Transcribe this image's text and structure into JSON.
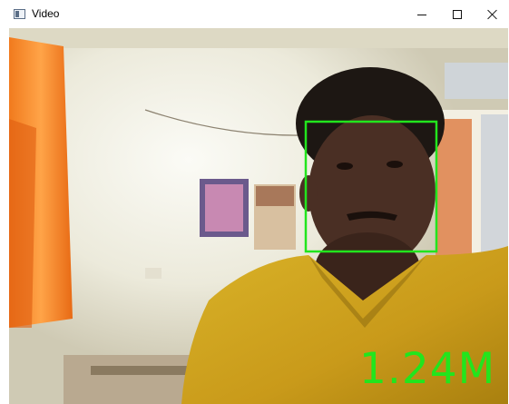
{
  "window": {
    "title": "Video",
    "icon": "app-window-icon",
    "controls": [
      "minimize-icon",
      "maximize-icon",
      "close-icon"
    ]
  },
  "video": {
    "overlay_text": "1.24M",
    "overlay_color": "#22e51d",
    "detection_box_color": "#22e51d"
  }
}
